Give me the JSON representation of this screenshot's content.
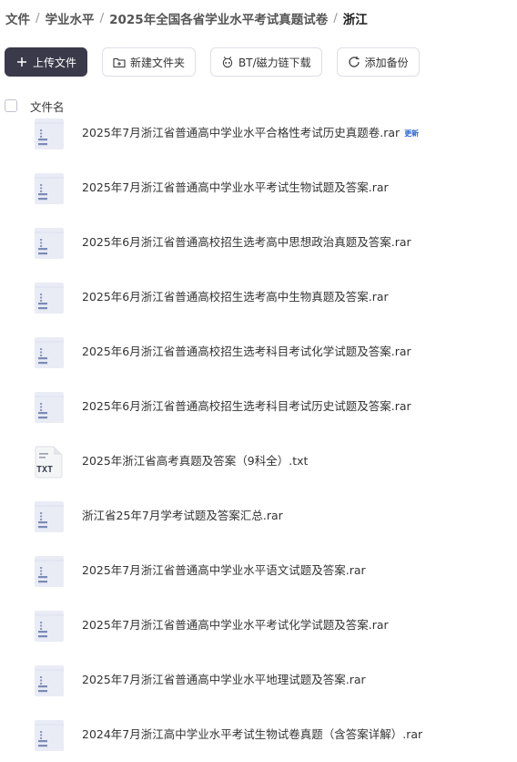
{
  "breadcrumb": [
    "文件",
    "学业水平",
    "2025年全国各省学业水平考试真题试卷",
    "浙江"
  ],
  "toolbar": {
    "upload_label": "上传文件",
    "new_folder_label": "新建文件夹",
    "bt_label": "BT/磁力链下载",
    "backup_label": "添加备份"
  },
  "list_header": {
    "filename_label": "文件名"
  },
  "files": [
    {
      "name": "2025年7月浙江省普通高中学业水平合格性考试历史真题卷.rar",
      "type": "rar",
      "badge": "更新"
    },
    {
      "name": "2025年7月浙江省普通高中学业水平考试生物试题及答案.rar",
      "type": "rar"
    },
    {
      "name": "2025年6月浙江省普通高校招生选考高中思想政治真题及答案.rar",
      "type": "rar"
    },
    {
      "name": "2025年6月浙江省普通高校招生选考高中生物真题及答案.rar",
      "type": "rar"
    },
    {
      "name": "2025年6月浙江省普通高校招生选考科目考试化学试题及答案.rar",
      "type": "rar"
    },
    {
      "name": "2025年6月浙江省普通高校招生选考科目考试历史试题及答案.rar",
      "type": "rar"
    },
    {
      "name": "2025年浙江省高考真题及答案（9科全）.txt",
      "type": "txt",
      "icon_label": "TXT"
    },
    {
      "name": "浙江省25年7月学考试题及答案汇总.rar",
      "type": "rar"
    },
    {
      "name": "2025年7月浙江省普通高中学业水平语文试题及答案.rar",
      "type": "rar"
    },
    {
      "name": "2025年7月浙江省普通高中学业水平考试化学试题及答案.rar",
      "type": "rar"
    },
    {
      "name": "2025年7月浙江省普通高中学业水平地理试题及答案.rar",
      "type": "rar"
    },
    {
      "name": "2024年7月浙江高中学业水平考试生物试卷真题（含答案详解）.rar",
      "type": "rar"
    }
  ]
}
